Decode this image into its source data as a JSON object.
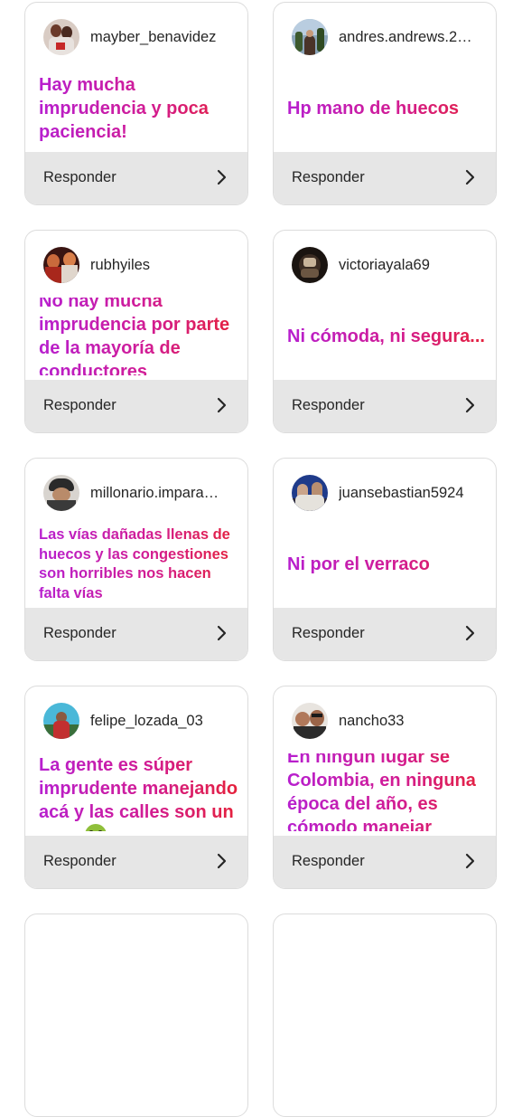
{
  "reply_label": "Responder",
  "chevron_icon": "chevron-right-icon",
  "colors": {
    "gradient_start": "#b71fcf",
    "gradient_mid": "#d21c93",
    "gradient_end": "#e5213a",
    "reply_bar": "#e6e6e6",
    "card_border": "#dcdcdc"
  },
  "responses": [
    {
      "username": "mayber_benavidez",
      "text": "Hay mucha imprudencia y poca paciencia!"
    },
    {
      "username": "andres.andrews.2…",
      "text": "Hp mano de huecos"
    },
    {
      "username": "rubhyiles",
      "text": "No hay mucha imprudencia por parte de la mayoría de conductores"
    },
    {
      "username": "victoriayala69",
      "text": "Ni cómoda, ni segura..."
    },
    {
      "username": "millonario.impara…",
      "text": "Las vías dañadas llenas de huecos y las congestiones son horribles nos hacen falta vías"
    },
    {
      "username": "juansebastian5924",
      "text": "Ni por el verraco"
    },
    {
      "username": "felipe_lozada_03",
      "text": "La gente es súper imprudente manejando acá y las calles son un asco",
      "emoji": "nauseated-face-emoji"
    },
    {
      "username": "nancho33",
      "text": "En ningún lugar se Colombia, en ninguna época del año, es cómodo manejar"
    }
  ]
}
